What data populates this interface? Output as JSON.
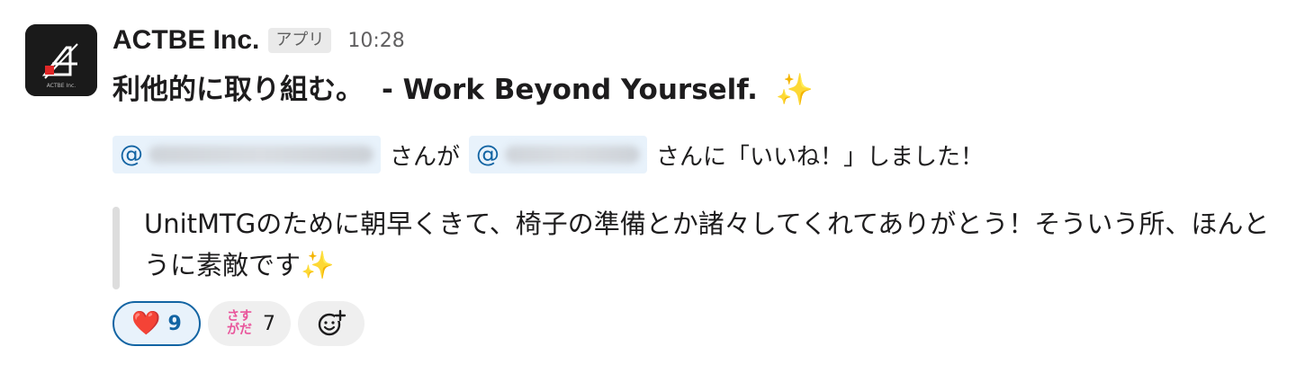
{
  "message": {
    "sender": "ACTBE Inc.",
    "app_badge": "アプリ",
    "time": "10:28",
    "title_jp": "利他的に取り組む。",
    "title_en": "- Work Beyond Yourself.",
    "title_emoji": "sparkles-icon",
    "mention_line": {
      "mention1_prefix": "@",
      "connector1": "さんが",
      "mention2_prefix": "@",
      "connector2": "さんに「いいね！」しました！"
    },
    "quote": {
      "text": "UnitMTGのために朝早くきて、椅子の準備とか諸々してくれてありがとう！そういう所、ほんとうに素敵です",
      "trailing_emoji": "✨"
    }
  },
  "reactions": [
    {
      "emoji": "❤️",
      "icon": "heart-icon",
      "count": "9",
      "active": true
    },
    {
      "emoji_lines": [
        "さす",
        "がだ"
      ],
      "icon": "sasuga-emoji-icon",
      "count": "7",
      "active": false
    }
  ],
  "add_reaction_icon": "add-reaction-icon",
  "colors": {
    "mention_bg": "#e8f2fb",
    "mention_text": "#1264a3",
    "active_border": "#1264a3",
    "quote_bar": "#dddddd",
    "sasuga_pink": "#e9559b"
  }
}
